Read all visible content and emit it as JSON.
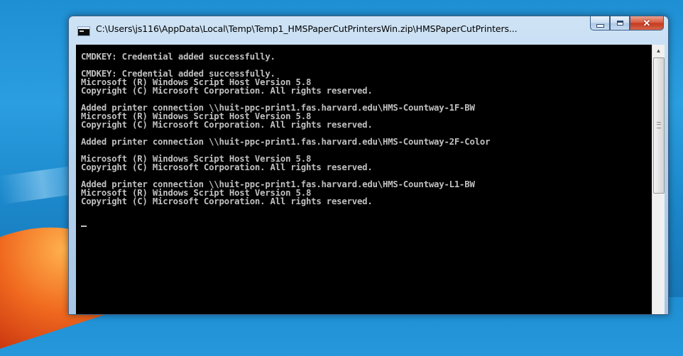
{
  "window": {
    "title": "C:\\Users\\js116\\AppData\\Local\\Temp\\Temp1_HMSPaperCutPrintersWin.zip\\HMSPaperCutPrinters..."
  },
  "caption_buttons": {
    "close_glyph": "✕"
  },
  "console": {
    "lines": [
      "CMDKEY: Credential added successfully.",
      "",
      "CMDKEY: Credential added successfully.",
      "Microsoft (R) Windows Script Host Version 5.8",
      "Copyright (C) Microsoft Corporation. All rights reserved.",
      "",
      "Added printer connection \\\\huit-ppc-print1.fas.harvard.edu\\HMS-Countway-1F-BW",
      "Microsoft (R) Windows Script Host Version 5.8",
      "Copyright (C) Microsoft Corporation. All rights reserved.",
      "",
      "Added printer connection \\\\huit-ppc-print1.fas.harvard.edu\\HMS-Countway-2F-Color",
      "",
      "Microsoft (R) Windows Script Host Version 5.8",
      "Copyright (C) Microsoft Corporation. All rights reserved.",
      "",
      "Added printer connection \\\\huit-ppc-print1.fas.harvard.edu\\HMS-Countway-L1-BW",
      "Microsoft (R) Windows Script Host Version 5.8",
      "Copyright (C) Microsoft Corporation. All rights reserved.",
      ""
    ]
  },
  "colors": {
    "console_bg": "#000000",
    "console_fg": "#c0c0c0",
    "close_button": "#c2391d",
    "desktop": "#1f8fd3"
  }
}
